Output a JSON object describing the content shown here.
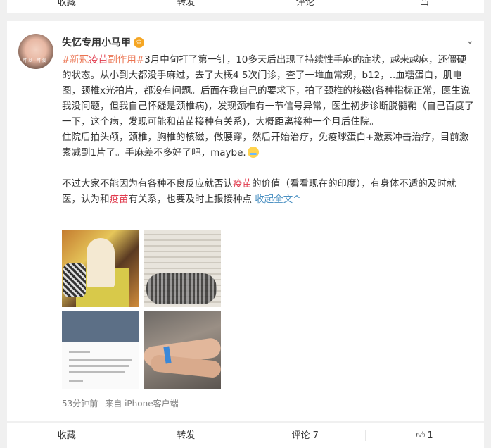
{
  "top_actions": {
    "favorite": "收藏",
    "repost": "转发",
    "comment": "评论",
    "like": "凸"
  },
  "post": {
    "username": "失忆专用小马甲",
    "vip_badge": "♔",
    "avatar_text": "可以 可爱",
    "paragraph1": {
      "hashtag": "#新冠疫苗副作用#",
      "hashtag_prefix": "#新冠",
      "hashtag_kw": "疫苗",
      "hashtag_suffix": "副作用#",
      "text": "3月中旬打了第一针，10多天后出现了持续性手麻的症状，越来越麻，还僵硬的状态。从小到大都没手麻过，去了大概4 5次门诊，查了一堆血常规，b12，..血糖蛋白，肌电图，颈椎x光拍片，都没有问题。后面在我自己的要求下，拍了颈椎的核磁(各种指标正常，医生说我没问题，但我自己怀疑是颈椎病)，发现颈椎有一节信号异常，医生初步诊断脱髓鞘（自己百度了一下，这个病，发现可能和苗苗接种有关系)，大概距离接种一个月后住院。"
    },
    "paragraph2": "住院后拍头颅，颈椎，胸椎的核磁，做腰穿，然后开始治疗，免疫球蛋白+激素冲击治疗，目前激素减到1片了。手麻差不多好了吧，maybe.",
    "paragraph3": {
      "part1": "不过大家不能因为有各种不良反应就否认",
      "kw1": "疫苗",
      "part2": "的价值（看看现在的印度），有身体不适的及时就医，认为和",
      "kw2": "疫苗",
      "part3": "有关系，也要及时上报接种点 ",
      "collapse": "收起全文^"
    },
    "meta": {
      "time": "53分钟前",
      "source": "来自 iPhone客户端"
    }
  },
  "bottom_actions": {
    "favorite": "收藏",
    "repost": "转发",
    "comment": "评论 7",
    "like_count": "1"
  },
  "icons": {
    "chevron": "chevron-down-icon",
    "like": "thumbs-up-icon",
    "vip": "crown-badge-icon",
    "emoji": "cold-sweat-emoji-icon"
  },
  "colors": {
    "topic": "#eb7350",
    "keyword": "#e0394c",
    "link": "#4a90c2",
    "meta": "#808080"
  }
}
